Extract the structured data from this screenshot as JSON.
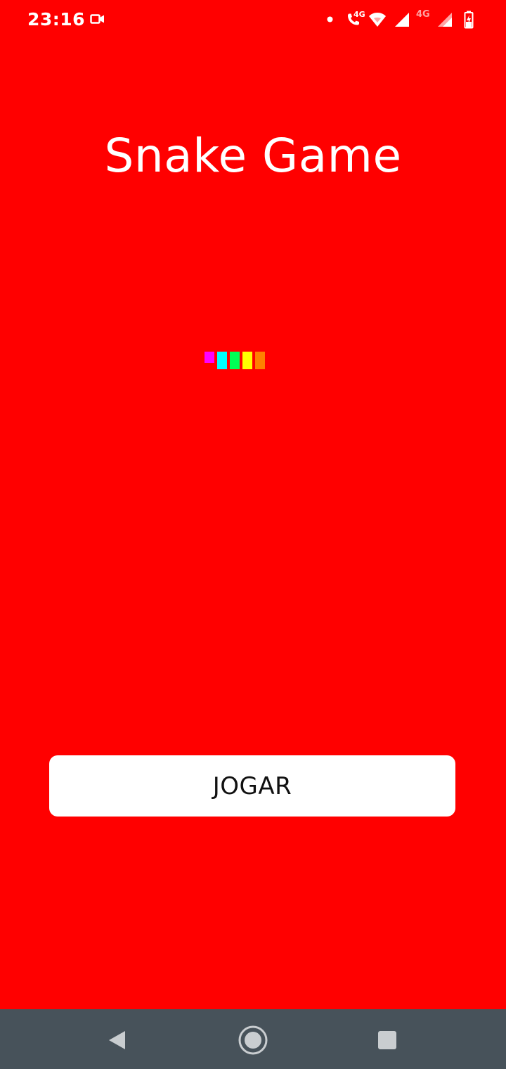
{
  "status_bar": {
    "time": "23:16",
    "network_label_1": "4G",
    "network_label_2": "4G",
    "icons": [
      "video-record-icon",
      "dot-icon",
      "wifi-call-icon",
      "wifi-icon",
      "signal-icon",
      "signal-roaming-icon",
      "battery-charging-icon"
    ]
  },
  "main": {
    "title": "Snake Game",
    "snake_segment_colors": [
      "#ff00ff",
      "#00ffff",
      "#00ff55",
      "#ffff00",
      "#ff8000"
    ],
    "play_button_label": "JOGAR"
  },
  "nav_bar": {
    "icons": [
      "back-icon",
      "home-icon",
      "recents-icon"
    ]
  },
  "colors": {
    "background": "#ff0000",
    "button": "#ffffff",
    "nav_bar": "#47525a"
  }
}
